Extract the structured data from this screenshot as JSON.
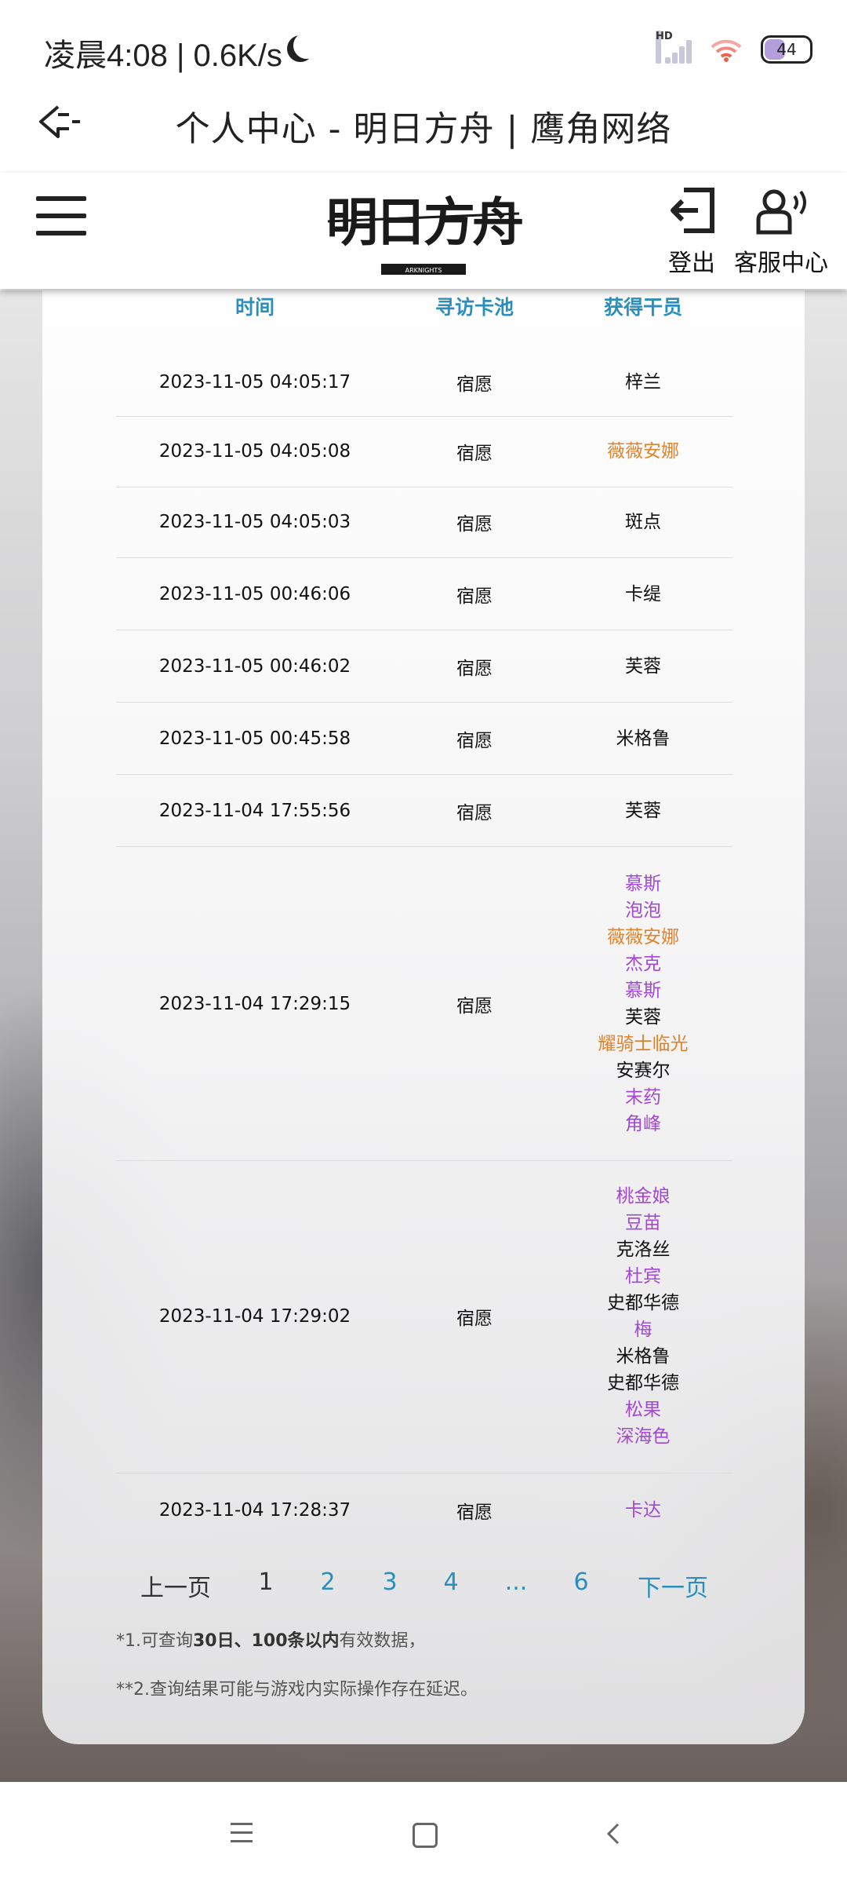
{
  "status_bar": {
    "time": "凌晨4:08 | 0.6K/s",
    "network_label": "HD",
    "battery_level": "44"
  },
  "title_bar": {
    "title": "个人中心 - 明日方舟 | 鹰角网络"
  },
  "header": {
    "logo_text": "明日方舟",
    "logo_subtext": "ARKNIGHTS",
    "logout_label": "登出",
    "service_label": "客服中心"
  },
  "table": {
    "columns": [
      "时间",
      "寻访卡池",
      "获得干员"
    ],
    "rows": [
      {
        "time": "2023-11-05 04:05:17",
        "pool": "宿愿",
        "operators": [
          {
            "name": "梓兰",
            "rarity": 3
          }
        ]
      },
      {
        "time": "2023-11-05 04:05:08",
        "pool": "宿愿",
        "operators": [
          {
            "name": "薇薇安娜",
            "rarity": 5
          }
        ]
      },
      {
        "time": "2023-11-05 04:05:03",
        "pool": "宿愿",
        "operators": [
          {
            "name": "斑点",
            "rarity": 3
          }
        ]
      },
      {
        "time": "2023-11-05 00:46:06",
        "pool": "宿愿",
        "operators": [
          {
            "name": "卡缇",
            "rarity": 3
          }
        ]
      },
      {
        "time": "2023-11-05 00:46:02",
        "pool": "宿愿",
        "operators": [
          {
            "name": "芙蓉",
            "rarity": 3
          }
        ]
      },
      {
        "time": "2023-11-05 00:45:58",
        "pool": "宿愿",
        "operators": [
          {
            "name": "米格鲁",
            "rarity": 3
          }
        ]
      },
      {
        "time": "2023-11-04 17:55:56",
        "pool": "宿愿",
        "operators": [
          {
            "name": "芙蓉",
            "rarity": 3
          }
        ]
      },
      {
        "time": "2023-11-04 17:29:15",
        "pool": "宿愿",
        "operators": [
          {
            "name": "慕斯",
            "rarity": 4
          },
          {
            "name": "泡泡",
            "rarity": 4
          },
          {
            "name": "薇薇安娜",
            "rarity": 5
          },
          {
            "name": "杰克",
            "rarity": 4
          },
          {
            "name": "慕斯",
            "rarity": 4
          },
          {
            "name": "芙蓉",
            "rarity": 3
          },
          {
            "name": "耀骑士临光",
            "rarity": 5
          },
          {
            "name": "安赛尔",
            "rarity": 3
          },
          {
            "name": "末药",
            "rarity": 4
          },
          {
            "name": "角峰",
            "rarity": 4
          }
        ]
      },
      {
        "time": "2023-11-04 17:29:02",
        "pool": "宿愿",
        "operators": [
          {
            "name": "桃金娘",
            "rarity": 4
          },
          {
            "name": "豆苗",
            "rarity": 4
          },
          {
            "name": "克洛丝",
            "rarity": 3
          },
          {
            "name": "杜宾",
            "rarity": 4
          },
          {
            "name": "史都华德",
            "rarity": 3
          },
          {
            "name": "梅",
            "rarity": 4
          },
          {
            "name": "米格鲁",
            "rarity": 3
          },
          {
            "name": "史都华德",
            "rarity": 3
          },
          {
            "name": "松果",
            "rarity": 4
          },
          {
            "name": "深海色",
            "rarity": 4
          }
        ]
      },
      {
        "time": "2023-11-04 17:28:37",
        "pool": "宿愿",
        "operators": [
          {
            "name": "卡达",
            "rarity": 4
          }
        ]
      }
    ]
  },
  "rarity_colors": {
    "3": "#111111",
    "4": "#a347d6",
    "5": "#e0832a"
  },
  "pagination": {
    "prev_label": "上一页",
    "current": "1",
    "pages": [
      "2",
      "3",
      "4",
      "...",
      "6"
    ],
    "next_label": "下一页"
  },
  "notes": {
    "note1_prefix": "*1.可查询",
    "note1_bold": "30日、100条以内",
    "note1_suffix": "有效数据，",
    "note2": "**2.查询结果可能与游戏内实际操作存在延迟。"
  },
  "colors": {
    "link": "#2a8fbd"
  }
}
